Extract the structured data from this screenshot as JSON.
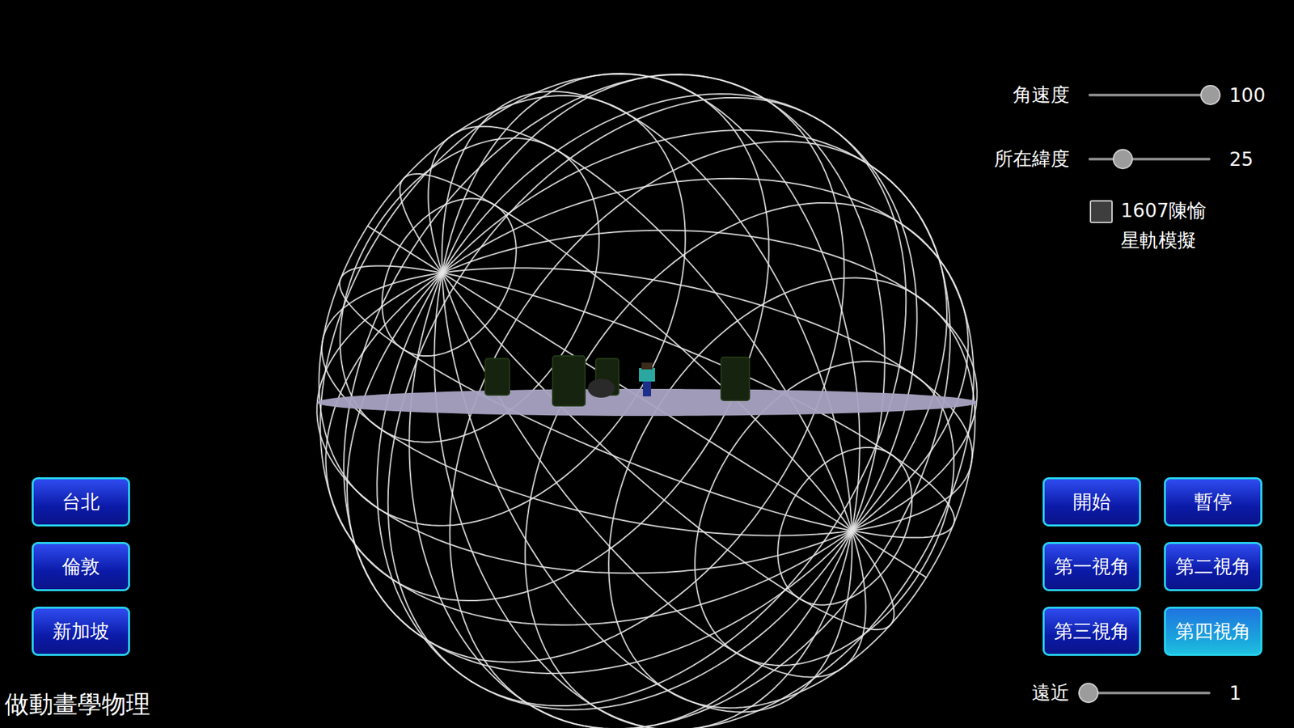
{
  "sliders": [
    {
      "label": "角速度",
      "value": "100",
      "level": 1
    },
    {
      "label": "所在緯度",
      "value": "25",
      "level": 0.28
    }
  ],
  "checkbox": {
    "lines": [
      "1607陳愉",
      "星軌模擬"
    ],
    "checked": false
  },
  "city_buttons": [
    {
      "label": "台北",
      "selected": false
    },
    {
      "label": "倫敦",
      "selected": false
    },
    {
      "label": "新加坡",
      "selected": false
    }
  ],
  "control_buttons": [
    {
      "label": "開始",
      "selected": false
    },
    {
      "label": "暫停",
      "selected": false
    },
    {
      "label": "第一視角",
      "selected": false
    },
    {
      "label": "第二視角",
      "selected": false
    },
    {
      "label": "第三視角",
      "selected": false
    },
    {
      "label": "第四視角",
      "selected": true
    }
  ],
  "zoom_slider": {
    "label": "遠近",
    "value": "1",
    "level": 0
  },
  "brand": "做動畫學物理"
}
